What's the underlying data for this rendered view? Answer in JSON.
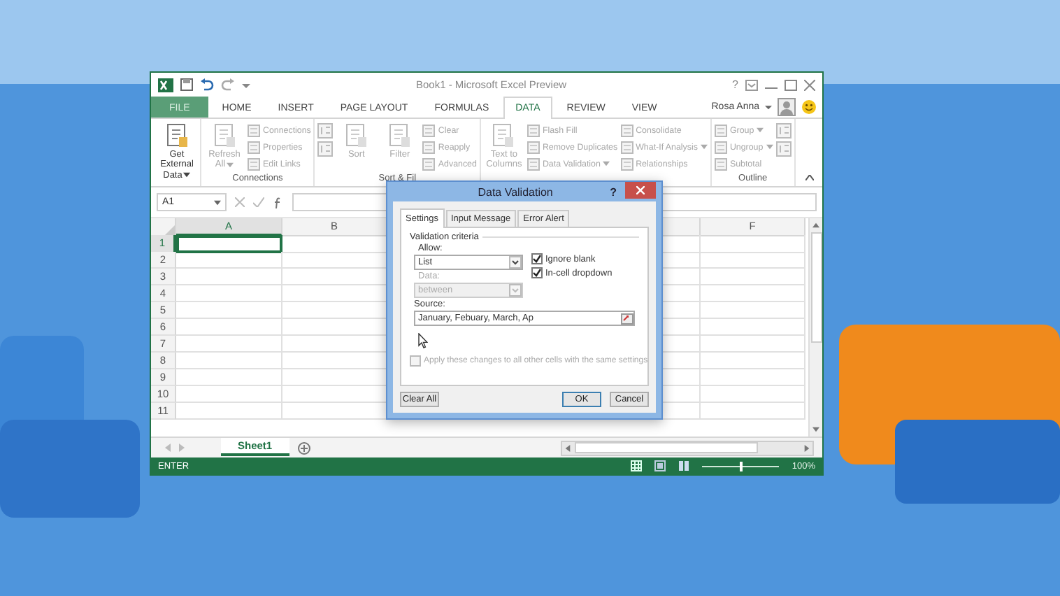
{
  "window": {
    "title": "Book1 - Microsoft Excel Preview",
    "help": "?",
    "user": "Rosa Anna"
  },
  "ribbon_tabs": [
    {
      "label": "FILE",
      "kind": "file",
      "selected": false
    },
    {
      "label": "HOME",
      "kind": "tab",
      "selected": false
    },
    {
      "label": "INSERT",
      "kind": "tab",
      "selected": false
    },
    {
      "label": "PAGE LAYOUT",
      "kind": "tab",
      "selected": false
    },
    {
      "label": "FORMULAS",
      "kind": "tab",
      "selected": false
    },
    {
      "label": "DATA",
      "kind": "tab",
      "selected": true
    },
    {
      "label": "REVIEW",
      "kind": "tab",
      "selected": false
    },
    {
      "label": "VIEW",
      "kind": "tab",
      "selected": false
    }
  ],
  "ribbon_groups": [
    {
      "columns": [
        {
          "kind": "big",
          "label": "Get External Data",
          "dropdown": true,
          "disabled": false
        }
      ]
    },
    {
      "label": "Connections",
      "columns": [
        {
          "kind": "big",
          "label": "Refresh All",
          "dropdown": true,
          "disabled": true
        },
        {
          "kind": "stack",
          "items": [
            {
              "label": "Connections",
              "disabled": true
            },
            {
              "label": "Properties",
              "disabled": true
            },
            {
              "label": "Edit Links",
              "disabled": true
            }
          ]
        }
      ]
    },
    {
      "label": "Sort & Fil",
      "columns": [
        {
          "kind": "stack",
          "items": [
            {
              "disabled": true
            },
            {
              "disabled": true
            }
          ]
        },
        {
          "kind": "big",
          "label": "Sort",
          "disabled": true
        },
        {
          "kind": "big",
          "label": "Filter",
          "disabled": true
        },
        {
          "kind": "stack",
          "items": [
            {
              "label": "Clear",
              "disabled": true
            },
            {
              "label": "Reapply",
              "disabled": true
            },
            {
              "label": "Advanced",
              "disabled": true
            }
          ]
        }
      ]
    },
    {
      "columns": [
        {
          "kind": "big",
          "label": "Text to Columns",
          "disabled": true
        },
        {
          "kind": "stack",
          "items": [
            {
              "label": "Flash Fill",
              "disabled": true
            },
            {
              "label": "Remove Duplicates",
              "disabled": true
            },
            {
              "label": "Data Validation",
              "dropdown": true,
              "disabled": true
            }
          ]
        },
        {
          "kind": "stack",
          "items": [
            {
              "label": "Consolidate",
              "disabled": true
            },
            {
              "label": "What-If Analysis",
              "dropdown": true,
              "disabled": true
            },
            {
              "label": "Relationships",
              "disabled": true
            }
          ]
        }
      ]
    },
    {
      "label": "Outline",
      "columns": [
        {
          "kind": "stack",
          "items": [
            {
              "label": "Group",
              "dropdown": true,
              "disabled": true
            },
            {
              "label": "Ungroup",
              "dropdown": true,
              "disabled": true
            },
            {
              "label": "Subtotal",
              "disabled": true
            }
          ]
        },
        {
          "kind": "stack",
          "items": [
            {
              "disabled": true
            },
            {
              "disabled": true
            }
          ]
        }
      ]
    }
  ],
  "formula_bar": {
    "name_box": "A1"
  },
  "sheet": {
    "columns": [
      {
        "label": "A",
        "selected": true
      },
      {
        "label": "B",
        "selected": false
      },
      {
        "label": "F",
        "selected": false
      }
    ],
    "rows": [
      {
        "label": "1",
        "selected": true
      },
      {
        "label": "2",
        "selected": false
      },
      {
        "label": "3",
        "selected": false
      },
      {
        "label": "4",
        "selected": false
      },
      {
        "label": "5",
        "selected": false
      },
      {
        "label": "6",
        "selected": false
      },
      {
        "label": "7",
        "selected": false
      },
      {
        "label": "8",
        "selected": false
      },
      {
        "label": "9",
        "selected": false
      },
      {
        "label": "10",
        "selected": false
      },
      {
        "label": "11",
        "selected": false
      }
    ]
  },
  "sheet_tabs": [
    {
      "label": "Sheet1",
      "selected": true
    }
  ],
  "status_bar": {
    "mode": "ENTER",
    "zoom": {
      "level": 0.5,
      "reading": "100%"
    }
  },
  "dialog": {
    "title": "Data Validation",
    "help": "?",
    "tabs": [
      {
        "label": "Settings",
        "selected": true
      },
      {
        "label": "Input Message",
        "selected": false
      },
      {
        "label": "Error Alert",
        "selected": false
      }
    ],
    "section": "Validation criteria",
    "fields": [
      {
        "kind": "select",
        "label": "Allow:",
        "value": "List",
        "disabled": false
      },
      {
        "kind": "select",
        "label": "Data:",
        "value": "between",
        "disabled": true
      },
      {
        "kind": "text",
        "label": "Source:",
        "value": "January, Febuary, March, Ap",
        "disabled": false
      }
    ],
    "options": [
      {
        "label": "Ignore blank",
        "checked": true
      },
      {
        "label": "In-cell dropdown",
        "checked": true
      }
    ],
    "apply_all": {
      "label": "Apply these changes to all other cells with the same settings",
      "checked": false,
      "disabled": true
    },
    "buttons": [
      {
        "label": "Clear All",
        "default": false
      },
      {
        "label": "OK",
        "default": true
      },
      {
        "label": "Cancel",
        "default": false
      }
    ]
  }
}
